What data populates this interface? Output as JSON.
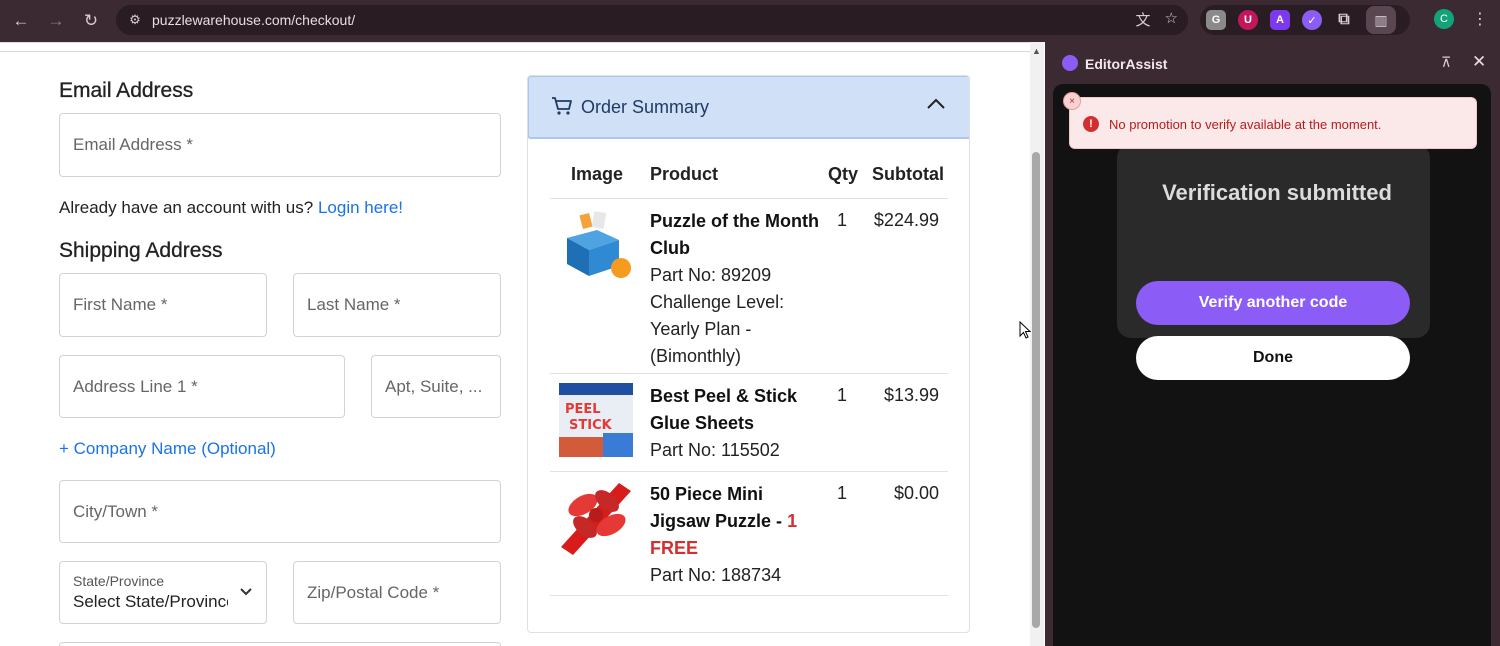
{
  "browser": {
    "url": "puzzlewarehouse.com/checkout/",
    "back_icon": "←",
    "forward_icon": "→",
    "reload_icon": "↻",
    "tune_icon": "⚙",
    "translate_icon": "文",
    "star_icon": "☆",
    "profile_initial": "C",
    "kebab": "⋮"
  },
  "checkout": {
    "email_heading": "Email Address",
    "email_placeholder": "Email Address *",
    "account_prompt": "Already have an account with us?",
    "login_link": "Login here!",
    "shipping_heading": "Shipping Address",
    "first_name_placeholder": "First Name *",
    "last_name_placeholder": "Last Name *",
    "address1_placeholder": "Address Line 1 *",
    "apt_placeholder": "Apt, Suite, ...",
    "company_link": "+ Company Name (Optional)",
    "city_placeholder": "City/Town *",
    "state_label": "State/Province",
    "state_value": "Select State/Province",
    "zip_placeholder": "Zip/Postal Code *"
  },
  "order_summary": {
    "title": "Order Summary",
    "columns": [
      "Image",
      "Product",
      "Qty",
      "Subtotal"
    ],
    "items": [
      {
        "name": "Puzzle of the Month Club",
        "details": "Part No: 89209 Challenge Level: Yearly Plan - (Bimonthly)",
        "qty": "1",
        "subtotal": "$224.99"
      },
      {
        "name": "Best Peel & Stick Glue Sheets",
        "details": "Part No: 115502",
        "qty": "1",
        "subtotal": "$13.99"
      },
      {
        "name": "50 Piece Mini Jigsaw Puzzle -",
        "name_highlight": "1 FREE",
        "details": "Part No: 188734",
        "qty": "1",
        "subtotal": "$0.00"
      }
    ]
  },
  "editor_assist": {
    "title": "EditorAssist",
    "ghost_heading": "Verification submitted",
    "verify_button": "Verify another code",
    "done_button": "Done",
    "toast_message": "No promotion to verify available at the moment.",
    "toast_icon": "!",
    "toast_close": "×",
    "close_icon": "✕",
    "pin_icon": "⊼"
  },
  "colors": {
    "accent_purple": "#8b5cf6",
    "link_blue": "#1a73e8",
    "free_red": "#d32f2f",
    "summary_header": "#cfe0f7"
  }
}
